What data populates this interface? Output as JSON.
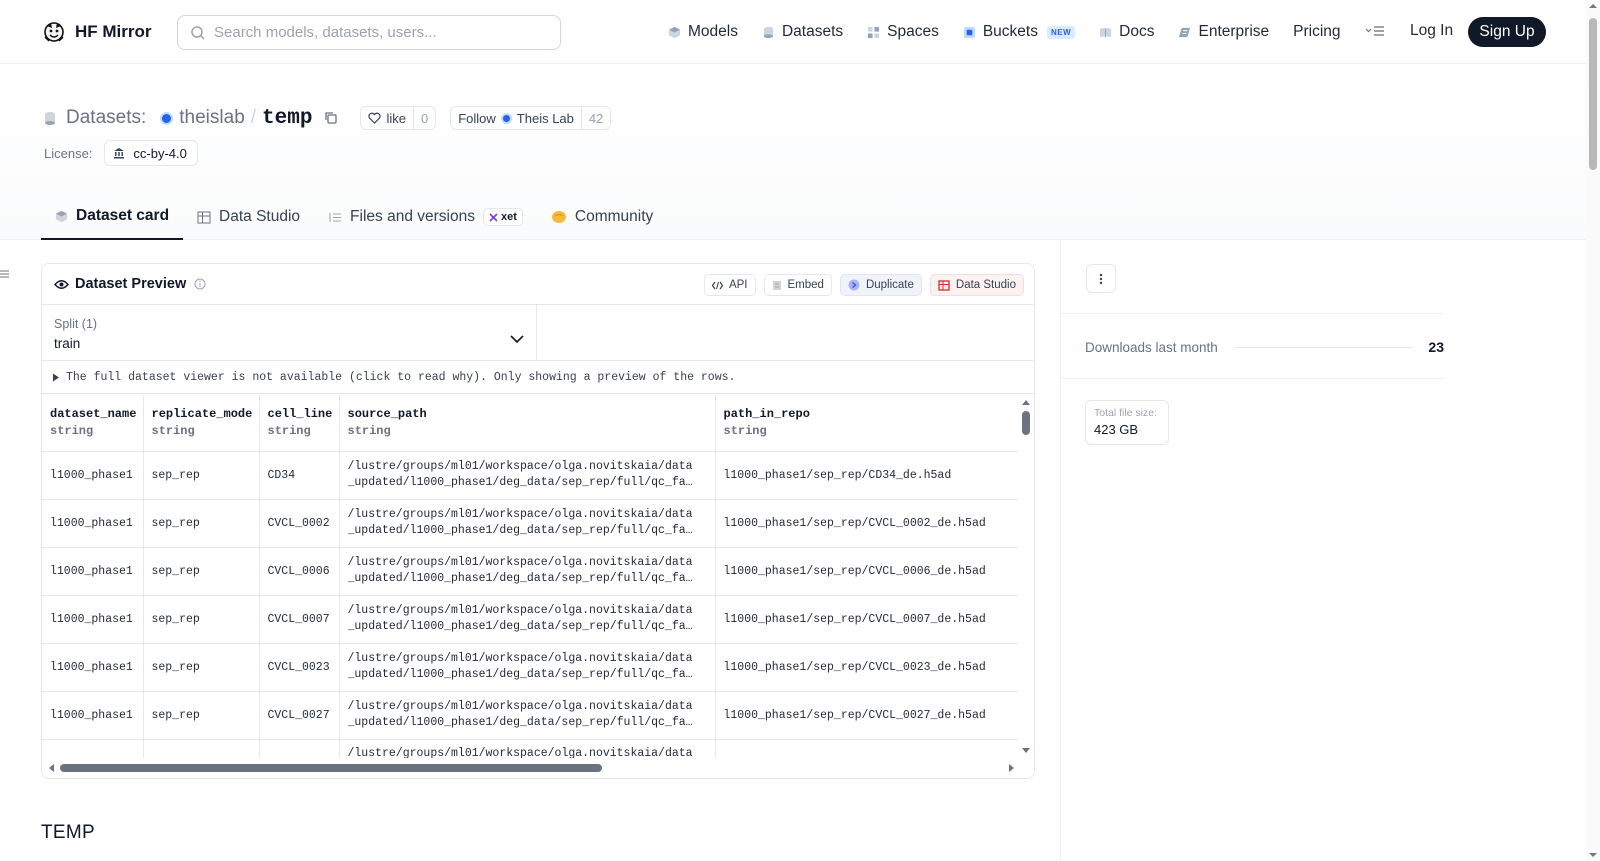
{
  "nav": {
    "brand": "HF Mirror",
    "search_placeholder": "Search models, datasets, users...",
    "links": {
      "models": "Models",
      "datasets": "Datasets",
      "spaces": "Spaces",
      "buckets": "Buckets",
      "buckets_badge": "NEW",
      "docs": "Docs",
      "enterprise": "Enterprise",
      "pricing": "Pricing"
    },
    "login": "Log In",
    "signup": "Sign Up"
  },
  "repo": {
    "type_label": "Datasets:",
    "owner": "theislab",
    "separator": "/",
    "name": "temp",
    "like_label": "like",
    "like_count": "0",
    "follow_label": "Follow",
    "follow_org": "Theis Lab",
    "follow_count": "42",
    "license_label": "License:",
    "license": "cc-by-4.0"
  },
  "tabs": {
    "dataset_card": "Dataset card",
    "data_studio": "Data Studio",
    "files": "Files and versions",
    "xet": "xet",
    "community": "Community"
  },
  "preview": {
    "title": "Dataset Preview",
    "api": "API",
    "embed": "Embed",
    "duplicate": "Duplicate",
    "data_studio": "Data Studio",
    "split_label": "Split (1)",
    "split_value": "train",
    "notice": "The full dataset viewer is not available (click to read why). Only showing a preview of the rows.",
    "columns": [
      {
        "name": "dataset_name",
        "type": "string"
      },
      {
        "name": "replicate_mode",
        "type": "string"
      },
      {
        "name": "cell_line",
        "type": "string"
      },
      {
        "name": "source_path",
        "type": "string"
      },
      {
        "name": "path_in_repo",
        "type": "string"
      }
    ],
    "rows": [
      {
        "dataset_name": "l1000_phase1",
        "replicate_mode": "sep_rep",
        "cell_line": "CD34",
        "source_path_1": "/lustre/groups/ml01/workspace/olga.novitskaia/data",
        "source_path_2": "_updated/l1000_phase1/deg_data/sep_rep/full/qc_fa…",
        "path_in_repo": "l1000_phase1/sep_rep/CD34_de.h5ad"
      },
      {
        "dataset_name": "l1000_phase1",
        "replicate_mode": "sep_rep",
        "cell_line": "CVCL_0002",
        "source_path_1": "/lustre/groups/ml01/workspace/olga.novitskaia/data",
        "source_path_2": "_updated/l1000_phase1/deg_data/sep_rep/full/qc_fa…",
        "path_in_repo": "l1000_phase1/sep_rep/CVCL_0002_de.h5ad"
      },
      {
        "dataset_name": "l1000_phase1",
        "replicate_mode": "sep_rep",
        "cell_line": "CVCL_0006",
        "source_path_1": "/lustre/groups/ml01/workspace/olga.novitskaia/data",
        "source_path_2": "_updated/l1000_phase1/deg_data/sep_rep/full/qc_fa…",
        "path_in_repo": "l1000_phase1/sep_rep/CVCL_0006_de.h5ad"
      },
      {
        "dataset_name": "l1000_phase1",
        "replicate_mode": "sep_rep",
        "cell_line": "CVCL_0007",
        "source_path_1": "/lustre/groups/ml01/workspace/olga.novitskaia/data",
        "source_path_2": "_updated/l1000_phase1/deg_data/sep_rep/full/qc_fa…",
        "path_in_repo": "l1000_phase1/sep_rep/CVCL_0007_de.h5ad"
      },
      {
        "dataset_name": "l1000_phase1",
        "replicate_mode": "sep_rep",
        "cell_line": "CVCL_0023",
        "source_path_1": "/lustre/groups/ml01/workspace/olga.novitskaia/data",
        "source_path_2": "_updated/l1000_phase1/deg_data/sep_rep/full/qc_fa…",
        "path_in_repo": "l1000_phase1/sep_rep/CVCL_0023_de.h5ad"
      },
      {
        "dataset_name": "l1000_phase1",
        "replicate_mode": "sep_rep",
        "cell_line": "CVCL_0027",
        "source_path_1": "/lustre/groups/ml01/workspace/olga.novitskaia/data",
        "source_path_2": "_updated/l1000_phase1/deg_data/sep_rep/full/qc_fa…",
        "path_in_repo": "l1000_phase1/sep_rep/CVCL_0027_de.h5ad"
      },
      {
        "dataset_name": "",
        "replicate_mode": "",
        "cell_line": "",
        "source_path_1": "/lustre/groups/ml01/workspace/olga.novitskaia/data",
        "source_path_2": "",
        "path_in_repo": ""
      }
    ]
  },
  "card": {
    "heading": "TEMP"
  },
  "sidebar": {
    "downloads_label": "Downloads last month",
    "downloads_value": "23",
    "filesize_label": "Total file size:",
    "filesize_value": "423 GB"
  },
  "colors": {
    "accent_dark": "#111827",
    "link_blue": "#2563eb",
    "community_yellow": "#f6b93b"
  }
}
